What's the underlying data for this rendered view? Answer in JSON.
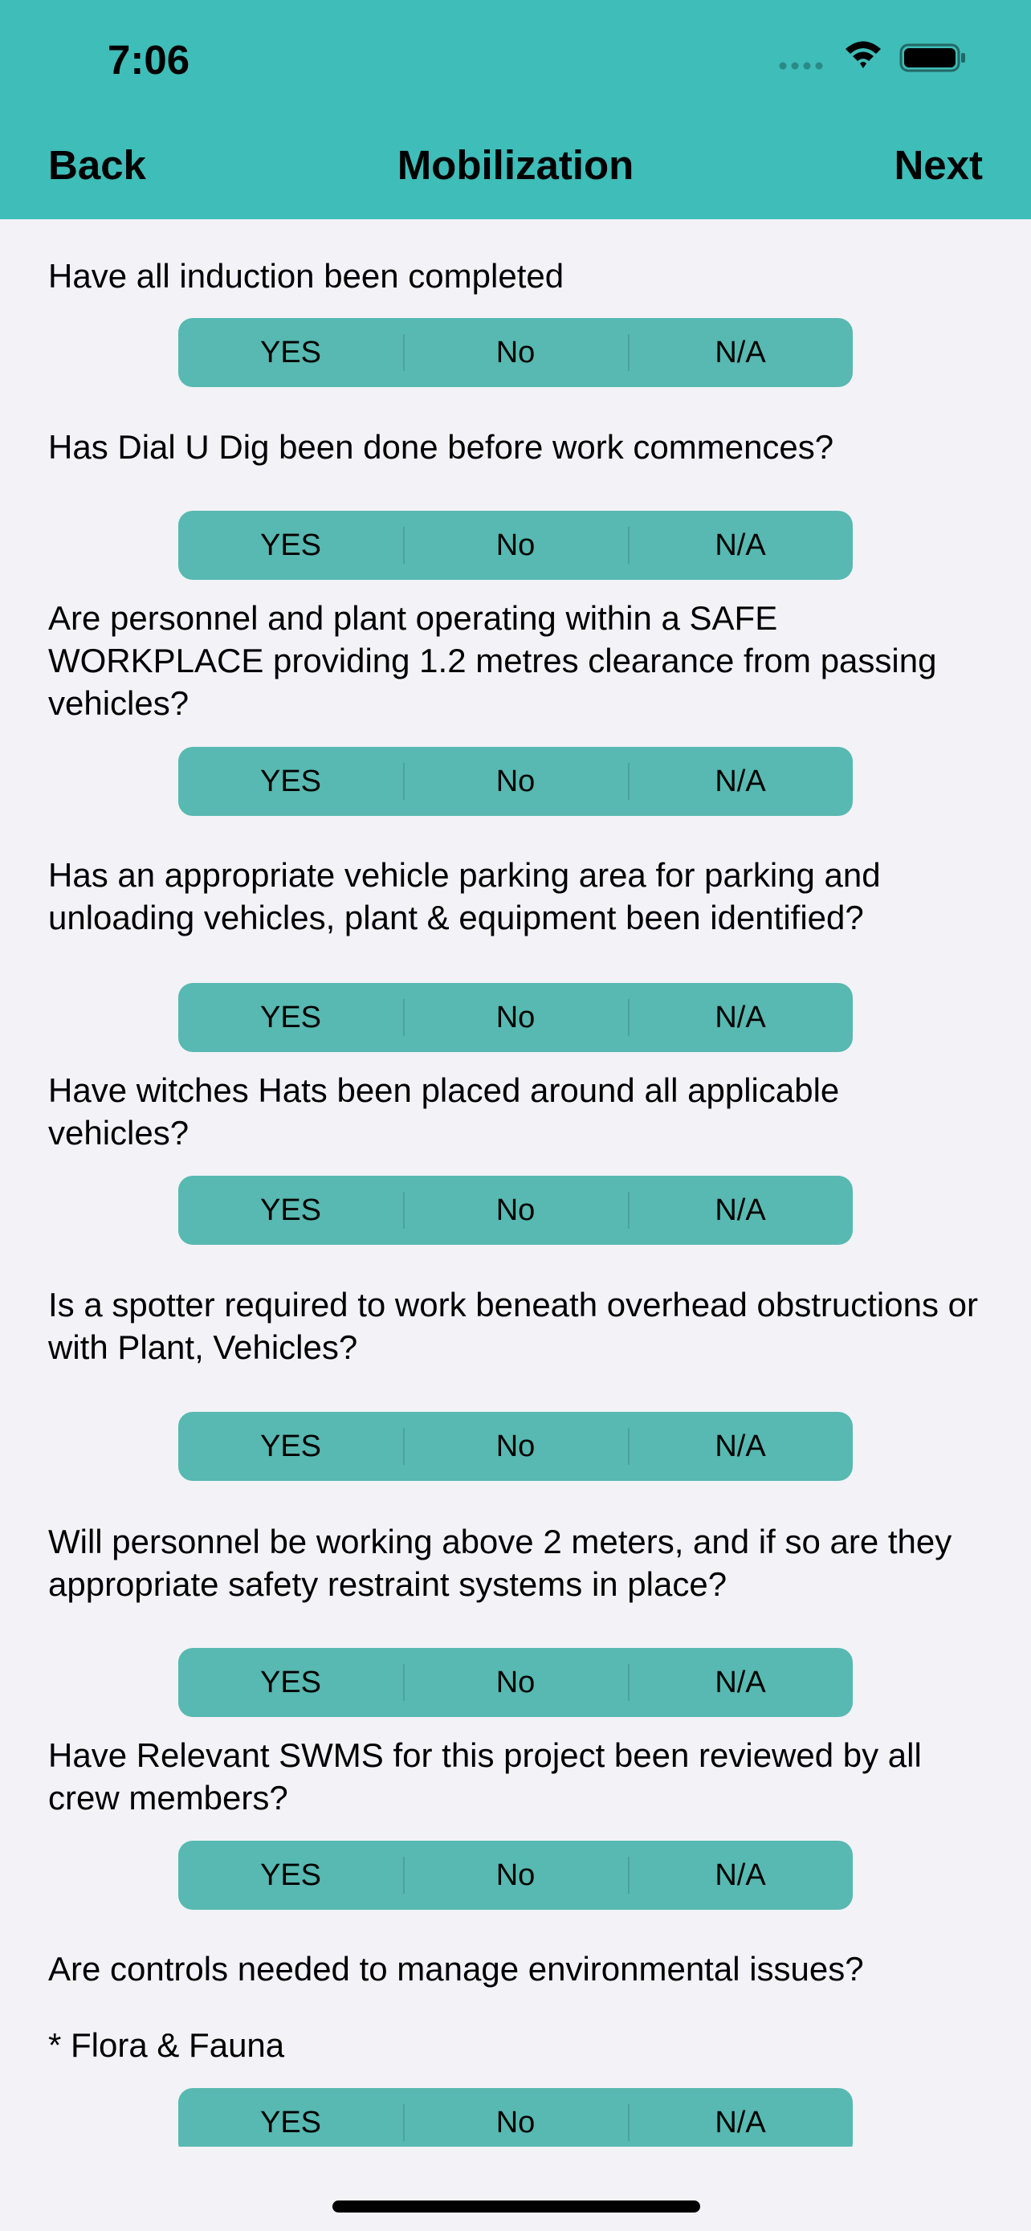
{
  "status_bar": {
    "time": "7:06"
  },
  "nav": {
    "back_label": "Back",
    "title": "Mobilization",
    "next_label": "Next"
  },
  "segment_labels": [
    "YES",
    "No",
    "N/A"
  ],
  "questions": [
    {
      "text": "Have all induction been completed",
      "note": ""
    },
    {
      "text": "Has Dial U Dig been done before work commences?",
      "note": ""
    },
    {
      "text": "Are personnel and plant operating within a SAFE WORKPLACE providing 1.2 metres clearance from passing vehicles?",
      "note": ""
    },
    {
      "text": "Has an appropriate vehicle parking area for parking and unloading vehicles, plant & equipment been identified?",
      "note": ""
    },
    {
      "text": "Have witches Hats been placed around all applicable vehicles?",
      "note": ""
    },
    {
      "text": "Is a spotter required to work beneath overhead obstructions or with Plant, Vehicles?",
      "note": ""
    },
    {
      "text": "Will personnel be working above 2 meters, and if so are they appropriate safety restraint systems in place?",
      "note": ""
    },
    {
      "text": "Have Relevant SWMS for this project been reviewed by all crew members?",
      "note": ""
    },
    {
      "text": "Are controls needed to manage environmental issues?",
      "note": "* Flora & Fauna"
    }
  ],
  "colors": {
    "header": "#3fbdb8",
    "segment": "#57b9b1",
    "background": "#f2f2f7"
  }
}
